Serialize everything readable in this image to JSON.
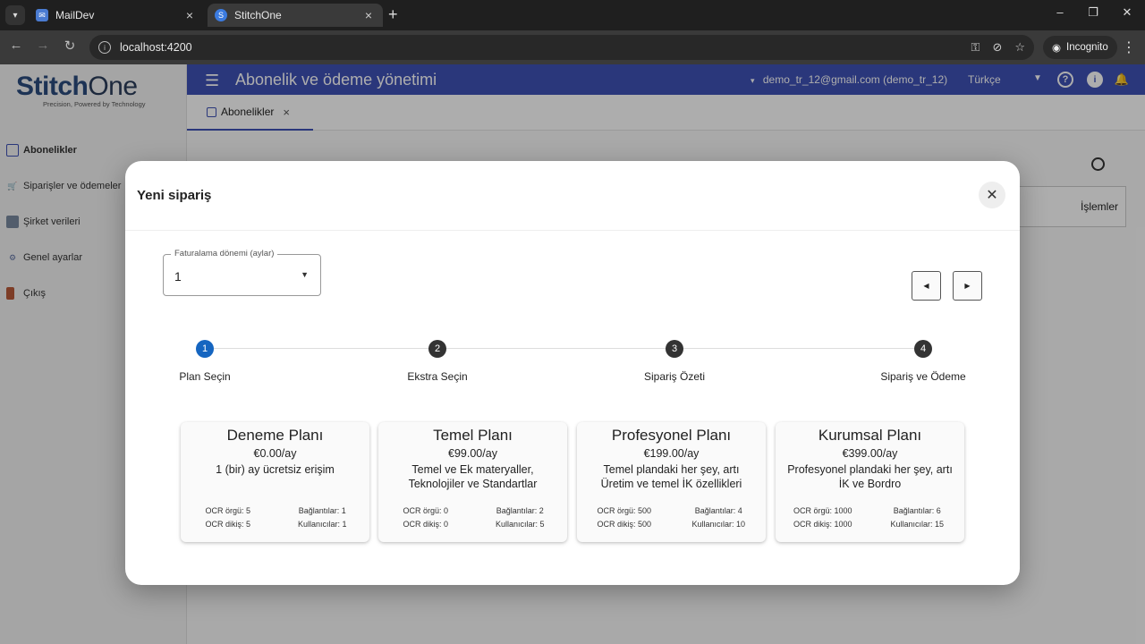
{
  "browser": {
    "tabs": [
      {
        "title": "MailDev"
      },
      {
        "title": "StitchOne"
      }
    ],
    "url": "localhost:4200",
    "incognito_label": "Incognito"
  },
  "app": {
    "logo": {
      "name_stitch": "StitchOne",
      "tagline": "Precision, Powered by Technology"
    },
    "title": "Abonelik ve ödeme yönetimi",
    "user": "demo_tr_12@gmail.com (demo_tr_12)",
    "language": "Türkçe",
    "sidebar": {
      "items": [
        {
          "label": "Abonelikler"
        },
        {
          "label": "Siparişler ve ödemeler"
        },
        {
          "label": "Şirket verileri"
        },
        {
          "label": "Genel ayarlar"
        },
        {
          "label": "Çıkış"
        }
      ]
    },
    "open_tab": "Abonelikler",
    "table_header_actions": "İşlemler"
  },
  "modal": {
    "title": "Yeni sipariş",
    "billing_select": {
      "label": "Faturalama dönemi (aylar)",
      "value": "1"
    },
    "steps": [
      {
        "number": "1",
        "label": "Plan Seçin"
      },
      {
        "number": "2",
        "label": "Ekstra Seçin"
      },
      {
        "number": "3",
        "label": "Sipariş Özeti"
      },
      {
        "number": "4",
        "label": "Sipariş ve Ödeme"
      }
    ],
    "plans": [
      {
        "name": "Deneme Planı",
        "price": "€0.00/ay",
        "desc": "1 (bir) ay ücretsiz erişim",
        "ocr_orgu": "OCR örgü: 5",
        "ocr_dikis": "OCR dikiş: 5",
        "baglantilar": "Bağlantılar: 1",
        "kullanicilar": "Kullanıcılar: 1"
      },
      {
        "name": "Temel Planı",
        "price": "€99.00/ay",
        "desc": "Temel ve Ek materyaller, Teknolojiler ve Standartlar",
        "ocr_orgu": "OCR örgü: 0",
        "ocr_dikis": "OCR dikiş: 0",
        "baglantilar": "Bağlantılar: 2",
        "kullanicilar": "Kullanıcılar: 5"
      },
      {
        "name": "Profesyonel Planı",
        "price": "€199.00/ay",
        "desc": "Temel plandaki her şey, artı Üretim ve temel İK özellikleri",
        "ocr_orgu": "OCR örgü: 500",
        "ocr_dikis": "OCR dikiş: 500",
        "baglantilar": "Bağlantılar: 4",
        "kullanicilar": "Kullanıcılar: 10"
      },
      {
        "name": "Kurumsal Planı",
        "price": "€399.00/ay",
        "desc": "Profesyonel plandaki her şey, artı İK ve Bordro",
        "ocr_orgu": "OCR örgü: 1000",
        "ocr_dikis": "OCR dikiş: 1000",
        "baglantilar": "Bağlantılar: 6",
        "kullanicilar": "Kullanıcılar: 15"
      }
    ]
  },
  "colors": {
    "primary": "#3f51b5",
    "step_active": "#1565c0",
    "logo": "#2b4c7e"
  }
}
